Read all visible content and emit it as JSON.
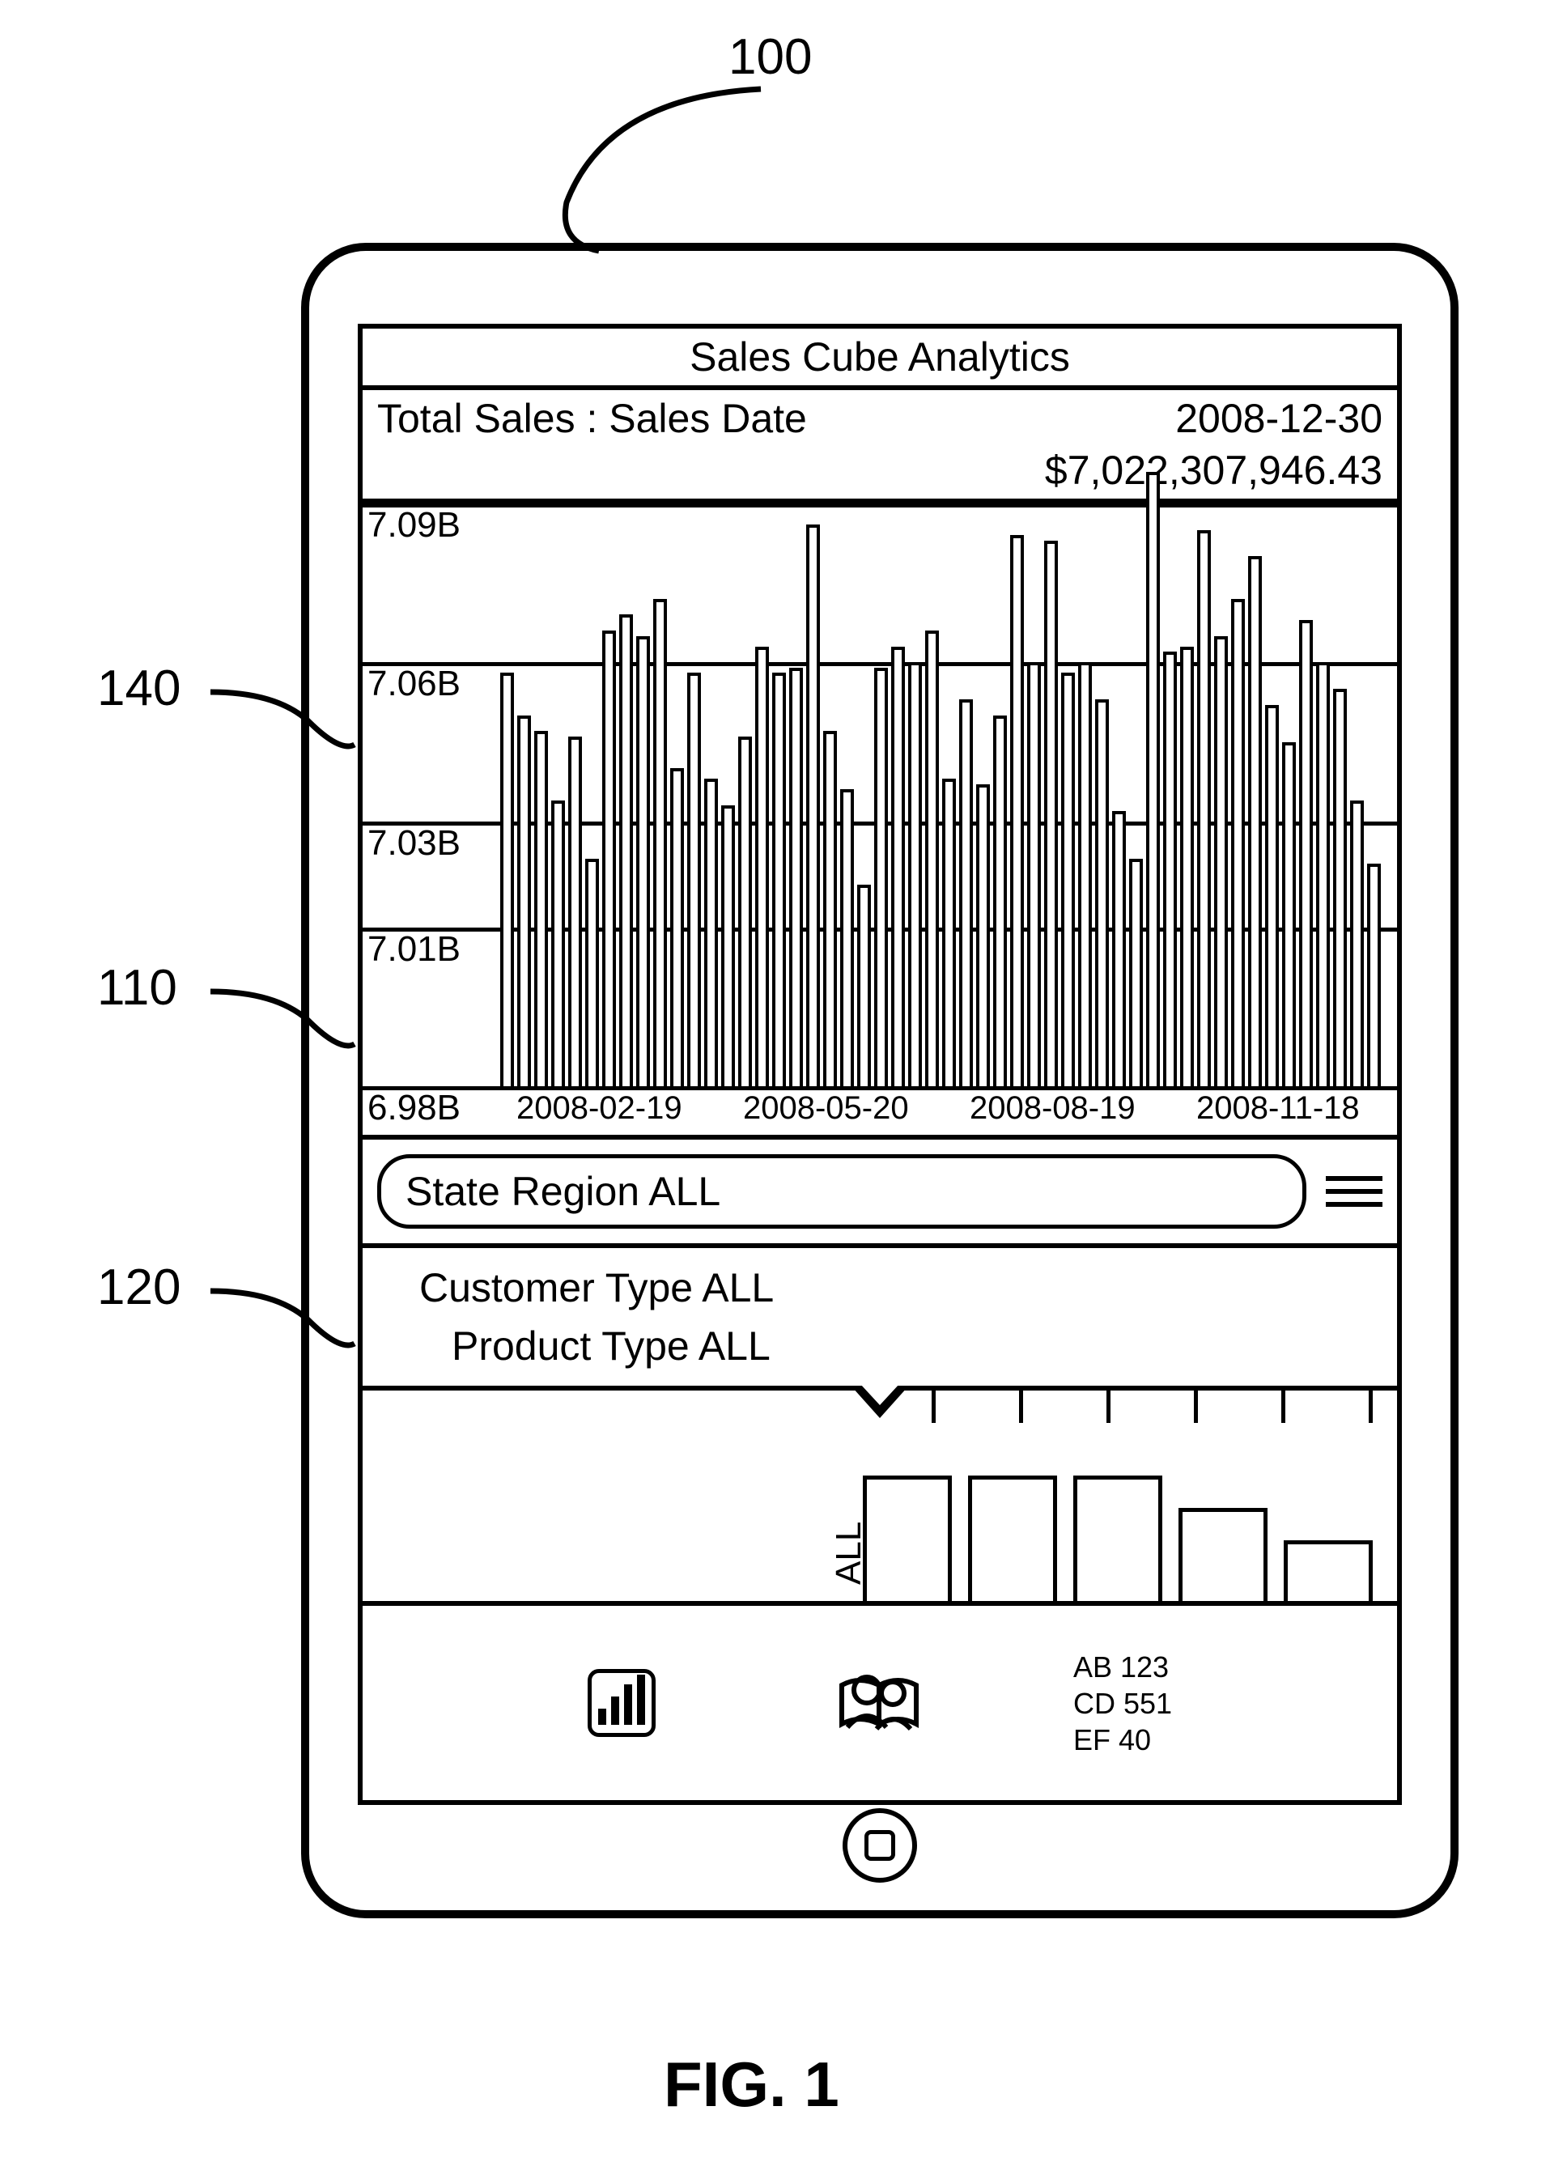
{
  "figure_label": "FIG. 1",
  "callouts": {
    "device": "100",
    "chart": "140",
    "axis_area": "110",
    "filter": "120"
  },
  "header": {
    "title": "Sales Cube Analytics"
  },
  "subheader": {
    "metric": "Total Sales : Sales Date",
    "date": "2008-12-30",
    "value": "$7,022,307,946.43"
  },
  "chart_data": {
    "type": "bar",
    "ylabel": "",
    "xlabel": "",
    "ylim": [
      6.98,
      7.09
    ],
    "y_ticks": [
      "7.09B",
      "7.06B",
      "7.03B",
      "7.01B",
      "6.98B"
    ],
    "x_ticks": [
      "2008-02-19",
      "2008-05-20",
      "2008-08-19",
      "2008-11-18"
    ],
    "values": [
      7.058,
      7.05,
      7.047,
      7.034,
      7.046,
      7.023,
      7.066,
      7.069,
      7.065,
      7.072,
      7.04,
      7.058,
      7.038,
      7.033,
      7.046,
      7.063,
      7.058,
      7.059,
      7.086,
      7.047,
      7.036,
      7.018,
      7.059,
      7.063,
      7.06,
      7.066,
      7.038,
      7.053,
      7.037,
      7.05,
      7.084,
      7.06,
      7.083,
      7.058,
      7.06,
      7.053,
      7.032,
      7.023,
      7.096,
      7.062,
      7.063,
      7.085,
      7.065,
      7.072,
      7.08,
      7.052,
      7.045,
      7.068,
      7.06,
      7.055,
      7.034,
      7.022
    ]
  },
  "filters": {
    "primary": "State Region ALL",
    "secondary": [
      "Customer Type ALL",
      "Product Type ALL"
    ],
    "mini_label": "ALL"
  },
  "toolbar_kv": [
    "AB 123",
    "CD 551",
    "EF 40"
  ]
}
